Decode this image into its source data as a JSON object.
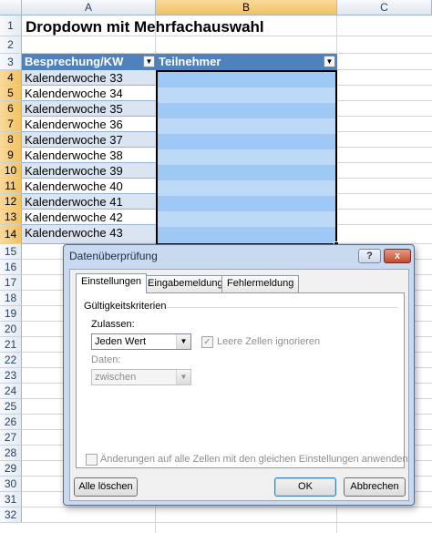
{
  "sheet": {
    "columns": [
      "A",
      "B",
      "C"
    ],
    "rows": [
      "1",
      "2",
      "3",
      "4",
      "5",
      "6",
      "7",
      "8",
      "9",
      "10",
      "11",
      "12",
      "13",
      "14",
      "15",
      "16",
      "17",
      "18",
      "19",
      "20",
      "21",
      "22",
      "23",
      "24",
      "25",
      "26",
      "27",
      "28",
      "29",
      "30",
      "31",
      "32"
    ],
    "title": "Dropdown mit Mehrfachauswahl",
    "table_header": {
      "col_a": "Besprechung/KW",
      "col_b": "Teilnehmer"
    },
    "weeks": [
      "Kalenderwoche 33",
      "Kalenderwoche 34",
      "Kalenderwoche 35",
      "Kalenderwoche 36",
      "Kalenderwoche 37",
      "Kalenderwoche 38",
      "Kalenderwoche 39",
      "Kalenderwoche 40",
      "Kalenderwoche 41",
      "Kalenderwoche 42",
      "Kalenderwoche 43"
    ],
    "dropdown_icon": "triangle-down-icon"
  },
  "dialog": {
    "title": "Datenüberprüfung",
    "help_label": "?",
    "close_label": "x",
    "tabs": [
      "Einstellungen",
      "Eingabemeldung",
      "Fehlermeldung"
    ],
    "section_label": "Gültigkeitskriterien",
    "allow_label": "Zulassen:",
    "allow_value": "Jeden Wert",
    "ignore_blank_label": "Leere Zellen ignorieren",
    "ignore_blank_check": "✓",
    "data_label": "Daten:",
    "data_value": "zwischen",
    "apply_all_label": "Änderungen auf alle Zellen mit den gleichen Einstellungen anwenden",
    "clear_all_label": "Alle löschen",
    "ok_label": "OK",
    "cancel_label": "Abbrechen"
  },
  "colors": {
    "table_header": "#4f81bd",
    "band_a": "#dbe5f1",
    "selection": "#9ec9f7",
    "dialog_frame": "#c9daf0"
  }
}
